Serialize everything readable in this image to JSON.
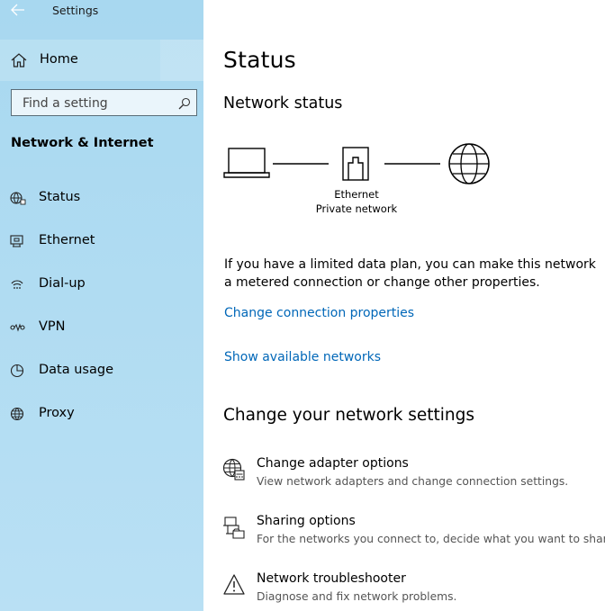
{
  "app": {
    "title": "Settings"
  },
  "sidebar": {
    "home_label": "Home",
    "search_placeholder": "Find a setting",
    "section_title": "Network & Internet",
    "items": [
      {
        "label": "Status",
        "icon": "status-icon"
      },
      {
        "label": "Ethernet",
        "icon": "ethernet-icon"
      },
      {
        "label": "Dial-up",
        "icon": "dial-up-icon"
      },
      {
        "label": "VPN",
        "icon": "vpn-icon"
      },
      {
        "label": "Data usage",
        "icon": "data-usage-icon"
      },
      {
        "label": "Proxy",
        "icon": "globe-icon"
      }
    ]
  },
  "main": {
    "title": "Status",
    "network_status_heading": "Network status",
    "diagram": {
      "device_name": "Ethernet",
      "network_type": "Private network"
    },
    "info_text": "If you have a limited data plan, you can make this network a metered connection or change other properties.",
    "link_change_properties": "Change connection properties",
    "link_show_networks": "Show available networks",
    "change_settings_heading": "Change your network settings",
    "settings": [
      {
        "title": "Change adapter options",
        "desc": "View network adapters and change connection settings.",
        "icon": "adapter-icon"
      },
      {
        "title": "Sharing options",
        "desc": "For the networks you connect to, decide what you want to share.",
        "icon": "sharing-icon"
      },
      {
        "title": "Network troubleshooter",
        "desc": "Diagnose and fix network problems.",
        "icon": "warning-icon"
      }
    ]
  },
  "colors": {
    "sidebar_bg": "#a8d8f0",
    "link": "#0067b8"
  }
}
